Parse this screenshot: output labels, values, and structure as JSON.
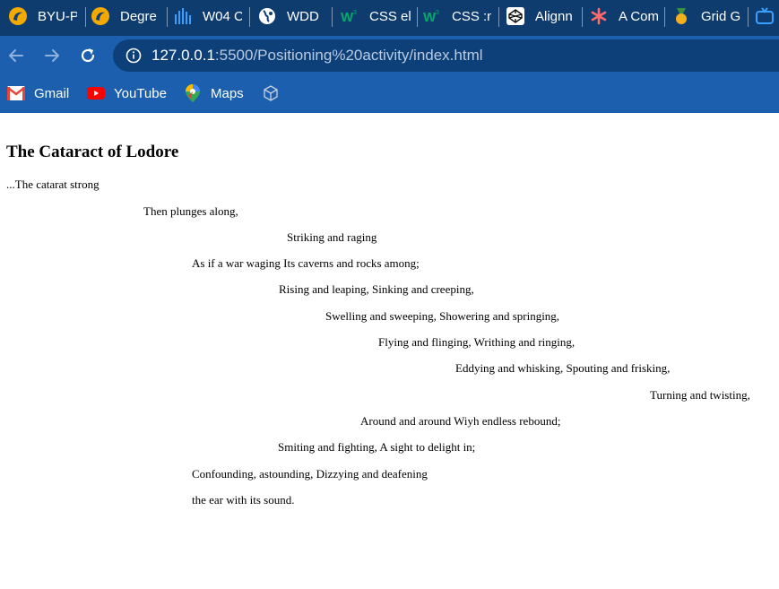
{
  "browser": {
    "tabs": [
      {
        "label": "BYU-P",
        "icon": "byu-pathway-icon"
      },
      {
        "label": "Degre",
        "icon": "byu-pathway-icon"
      },
      {
        "label": "W04 C",
        "icon": "bars-chart-icon"
      },
      {
        "label": "WDD",
        "icon": "globe-icon"
      },
      {
        "label": "CSS el",
        "icon": "w3schools-icon"
      },
      {
        "label": "CSS :n",
        "icon": "w3schools-icon"
      },
      {
        "label": "Alignn",
        "icon": "codepen-icon"
      },
      {
        "label": "A Com",
        "icon": "asterisk-icon"
      },
      {
        "label": "Grid G",
        "icon": "medal-icon"
      }
    ],
    "url": {
      "host": "127.0.0.1",
      "path": ":5500/Positioning%20activity/index.html"
    },
    "bookmarks": [
      {
        "label": "Gmail",
        "icon": "gmail-icon"
      },
      {
        "label": "YouTube",
        "icon": "youtube-icon"
      },
      {
        "label": "Maps",
        "icon": "maps-pin-icon"
      }
    ]
  },
  "page": {
    "title": "The Cataract of Lodore",
    "lines": [
      "...The catarat strong",
      "Then plunges along,",
      "Striking and raging",
      "As if a war waging Its caverns and rocks among;",
      "Rising and leaping, Sinking and creeping,",
      "Swelling and sweeping, Showering and springing,",
      "Flying and flinging, Writhing and ringing,",
      "Eddying and whisking, Spouting and frisking,",
      "Turning and twisting,",
      "Around and around Wiyh endless rebound;",
      "Smiting and fighting, A sight to delight in;",
      "Confounding, astounding, Dizzying and deafening",
      "the ear with its sound."
    ]
  }
}
